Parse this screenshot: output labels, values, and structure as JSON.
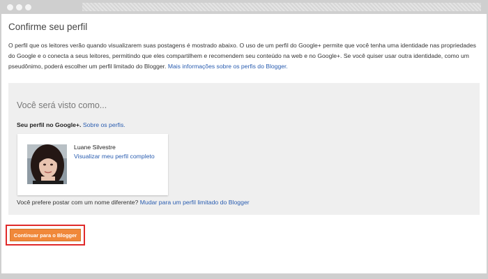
{
  "page": {
    "title": "Confirme seu perfil",
    "intro_text": "O perfil que os leitores verão quando visualizarem suas postagens é mostrado abaixo. O uso de um perfil do Google+ permite que você tenha uma identidade nas propriedades do Google e o conecta a seus leitores, permitindo que eles compartilhem e recomendem seu conteúdo na web e no Google+. Se você quiser usar outra identidade, como um pseudônimo, poderá escolher um perfil limitado do Blogger.",
    "intro_link": "Mais informações sobre os perfis do Blogger."
  },
  "panel": {
    "heading": "Você será visto como...",
    "profile_label": "Seu perfil no Google+.",
    "profile_link": "Sobre os perfis.",
    "card": {
      "name": "Luane Silvestre",
      "view_link": "Visualizar meu perfil completo"
    },
    "alt_text": "Você prefere postar com um nome diferente?",
    "alt_link": "Mudar para um perfil limitado do Blogger"
  },
  "cta": {
    "label": "Continuar para o Blogger",
    "color": "#f0883a",
    "highlight_color": "#e02a2a"
  }
}
